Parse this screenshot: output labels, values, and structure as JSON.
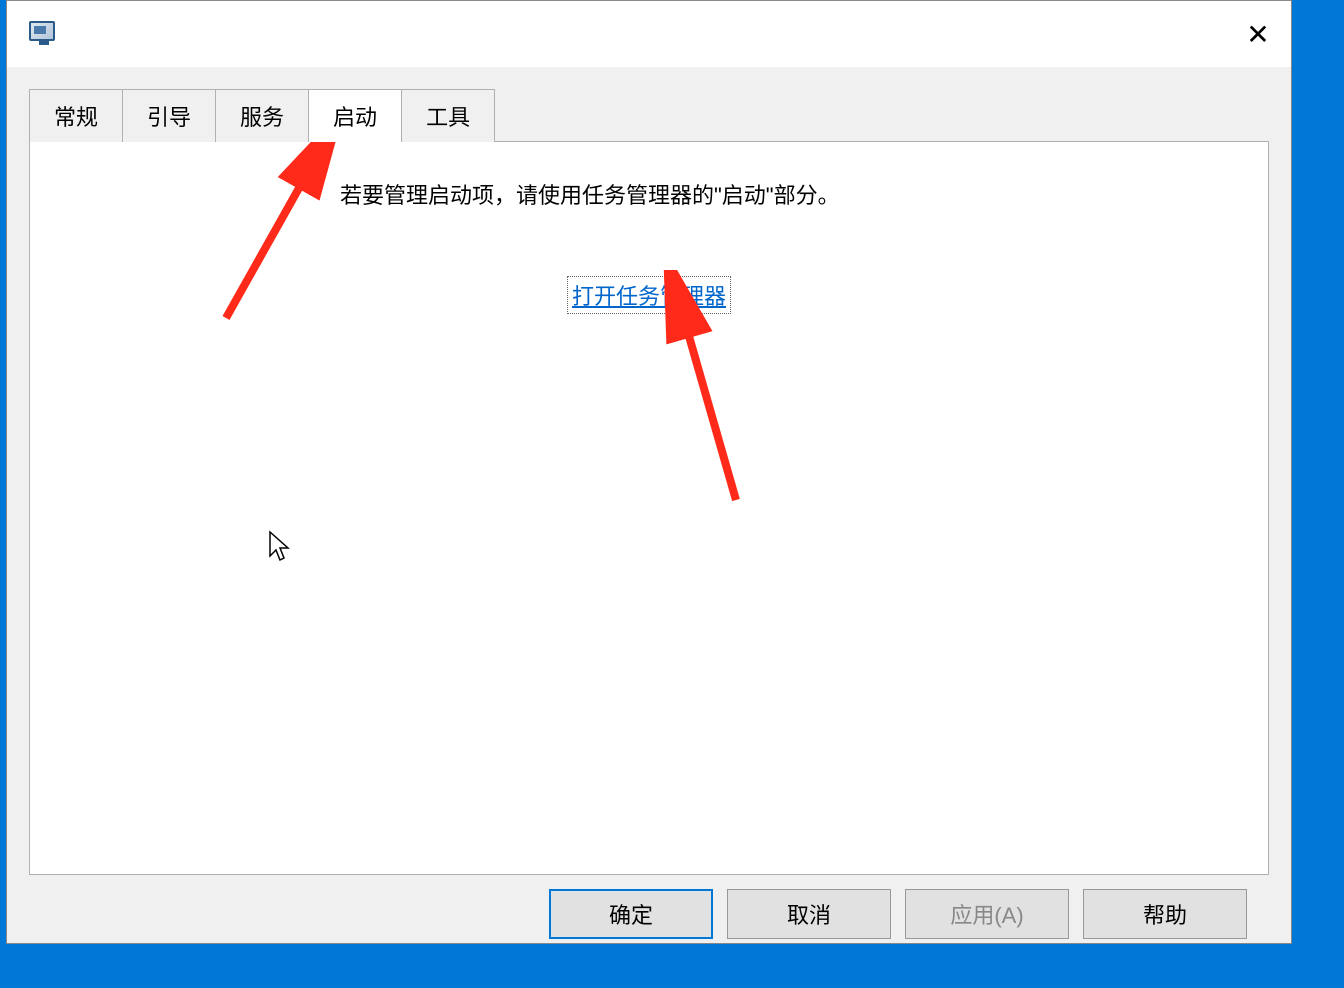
{
  "tabs": {
    "general": "常规",
    "boot": "引导",
    "services": "服务",
    "startup": "启动",
    "tools": "工具"
  },
  "panel": {
    "info": "若要管理启动项，请使用任务管理器的\"启动\"部分。",
    "link": "打开任务管理器"
  },
  "buttons": {
    "ok": "确定",
    "cancel": "取消",
    "apply": "应用(A)",
    "help": "帮助"
  }
}
